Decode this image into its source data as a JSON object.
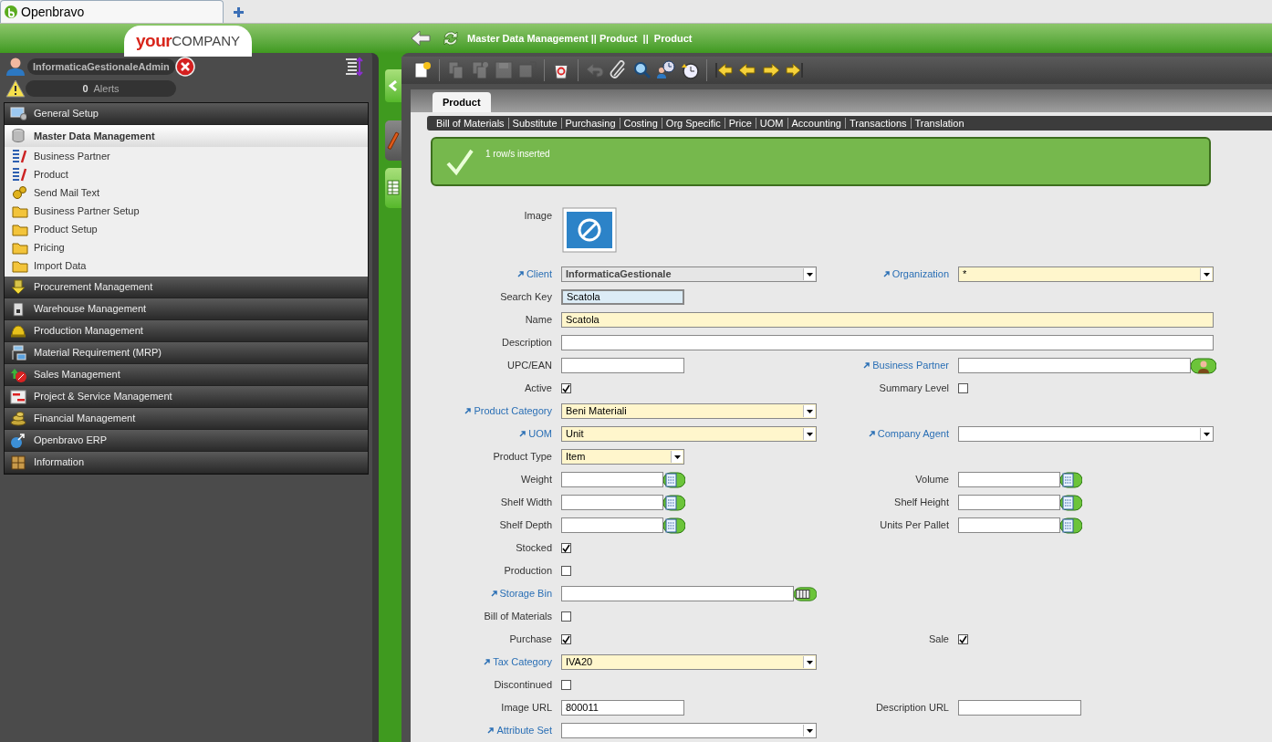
{
  "browser": {
    "tab_title": "Openbravo"
  },
  "header": {
    "logo": {
      "part_1": "your",
      "part_2": "COMPANY"
    },
    "breadcrumb": "Master Data Management || Product  ||  Product"
  },
  "user": {
    "name": "InformaticaGestionaleAdmin"
  },
  "alerts": {
    "count": "0",
    "label": "Alerts"
  },
  "menu": [
    {
      "label": "General Setup",
      "expanded": false
    },
    {
      "label": "Master Data Management",
      "expanded": true,
      "children": [
        {
          "label": "Business Partner",
          "kind": "window"
        },
        {
          "label": "Product",
          "kind": "window"
        },
        {
          "label": "Send Mail Text",
          "kind": "process"
        },
        {
          "label": "Business Partner Setup",
          "kind": "folder"
        },
        {
          "label": "Product Setup",
          "kind": "folder"
        },
        {
          "label": "Pricing",
          "kind": "folder"
        },
        {
          "label": "Import Data",
          "kind": "folder"
        }
      ]
    },
    {
      "label": "Procurement Management",
      "expanded": false
    },
    {
      "label": "Warehouse Management",
      "expanded": false
    },
    {
      "label": "Production Management",
      "expanded": false
    },
    {
      "label": "Material Requirement (MRP)",
      "expanded": false
    },
    {
      "label": "Sales Management",
      "expanded": false
    },
    {
      "label": "Project & Service Management",
      "expanded": false
    },
    {
      "label": "Financial Management",
      "expanded": false
    },
    {
      "label": "Openbravo ERP",
      "expanded": false
    },
    {
      "label": "Information",
      "expanded": false
    }
  ],
  "view_tabs": [
    {
      "kind": "edit",
      "selected": true
    },
    {
      "kind": "grid",
      "selected": false
    }
  ],
  "toolbar": [
    [
      {
        "kind": "new",
        "disabled": false
      }
    ],
    [
      {
        "kind": "copy",
        "disabled": true
      },
      {
        "kind": "copy-new",
        "disabled": true
      },
      {
        "kind": "save",
        "disabled": true
      },
      {
        "kind": "save-new",
        "disabled": true
      }
    ],
    [
      {
        "kind": "delete",
        "disabled": false
      }
    ],
    [
      {
        "kind": "undo",
        "disabled": true
      },
      {
        "kind": "attach",
        "disabled": false
      },
      {
        "kind": "search",
        "disabled": false
      },
      {
        "kind": "audit",
        "disabled": false
      },
      {
        "kind": "history",
        "disabled": false
      }
    ],
    [
      {
        "kind": "first",
        "disabled": false
      },
      {
        "kind": "previous",
        "disabled": false
      },
      {
        "kind": "next",
        "disabled": false
      },
      {
        "kind": "last",
        "disabled": false
      }
    ]
  ],
  "tabs": [
    {
      "label": "Product",
      "selected": true
    }
  ],
  "subtabs": [
    "Bill of Materials",
    "Substitute",
    "Purchasing",
    "Costing",
    "Org Specific",
    "Price",
    "UOM",
    "Accounting",
    "Transactions",
    "Translation"
  ],
  "message": {
    "kind": "success",
    "text": "1 row/s inserted"
  },
  "form_rows": [
    {
      "left": {
        "label": "Image",
        "kind": "image",
        "link": false
      }
    },
    {
      "left": {
        "label": "Client",
        "kind": "combo",
        "link": true,
        "required": false,
        "readonly": true,
        "value": "InformaticaGestionale"
      },
      "right": {
        "label": "Organization",
        "kind": "combo",
        "link": true,
        "required": true,
        "value": "*"
      }
    },
    {
      "left": {
        "label": "Search Key",
        "kind": "text",
        "link": false,
        "required": true,
        "focused": true,
        "value": "Scatola"
      }
    },
    {
      "left": {
        "label": "Name",
        "kind": "wide-text",
        "link": false,
        "required": true,
        "value": "Scatola"
      }
    },
    {
      "left": {
        "label": "Description",
        "kind": "wide-text",
        "link": false,
        "required": false
      }
    },
    {
      "left": {
        "label": "UPC/EAN",
        "kind": "text",
        "link": false,
        "required": false
      },
      "right": {
        "label": "Business Partner",
        "kind": "search",
        "link": true,
        "required": false
      }
    },
    {
      "left": {
        "label": "Active",
        "kind": "checkbox",
        "link": false,
        "checked": true
      },
      "right": {
        "label": "Summary Level",
        "kind": "checkbox",
        "link": false,
        "checked": false
      }
    },
    {
      "left": {
        "label": "Product Category",
        "kind": "combo",
        "link": true,
        "required": true,
        "value": "Beni Materiali"
      }
    },
    {
      "left": {
        "label": "UOM",
        "kind": "combo",
        "link": true,
        "required": true,
        "value": "Unit"
      },
      "right": {
        "label": "Company Agent",
        "kind": "combo",
        "link": true,
        "required": false
      }
    },
    {
      "left": {
        "label": "Product Type",
        "kind": "short-combo",
        "link": false,
        "required": true,
        "value": "Item"
      }
    },
    {
      "left": {
        "label": "Weight",
        "kind": "number",
        "link": false,
        "required": false
      },
      "right": {
        "label": "Volume",
        "kind": "number",
        "link": false,
        "required": false
      }
    },
    {
      "left": {
        "label": "Shelf Width",
        "kind": "number",
        "link": false,
        "required": false
      },
      "right": {
        "label": "Shelf Height",
        "kind": "number",
        "link": false,
        "required": false
      }
    },
    {
      "left": {
        "label": "Shelf Depth",
        "kind": "number",
        "link": false,
        "required": false
      },
      "right": {
        "label": "Units Per Pallet",
        "kind": "number",
        "link": false,
        "required": false
      }
    },
    {
      "left": {
        "label": "Stocked",
        "kind": "checkbox",
        "link": false,
        "checked": true
      }
    },
    {
      "left": {
        "label": "Production",
        "kind": "checkbox",
        "link": false,
        "checked": false
      }
    },
    {
      "left": {
        "label": "Storage Bin",
        "kind": "locator",
        "link": true,
        "required": false
      }
    },
    {
      "left": {
        "label": "Bill of Materials",
        "kind": "checkbox",
        "link": false,
        "checked": false
      }
    },
    {
      "left": {
        "label": "Purchase",
        "kind": "checkbox",
        "link": false,
        "checked": true
      },
      "right": {
        "label": "Sale",
        "kind": "checkbox",
        "link": false,
        "checked": true
      }
    },
    {
      "left": {
        "label": "Tax Category",
        "kind": "combo",
        "link": true,
        "required": true,
        "value": "IVA20"
      }
    },
    {
      "left": {
        "label": "Discontinued",
        "kind": "checkbox",
        "link": false,
        "checked": false
      }
    },
    {
      "left": {
        "label": "Image URL",
        "kind": "text",
        "link": false,
        "required": false,
        "value": "800011"
      },
      "right": {
        "label": "Description URL",
        "kind": "text",
        "link": false,
        "required": false
      }
    },
    {
      "left": {
        "label": "Attribute Set",
        "kind": "combo",
        "link": true,
        "required": false
      }
    }
  ]
}
